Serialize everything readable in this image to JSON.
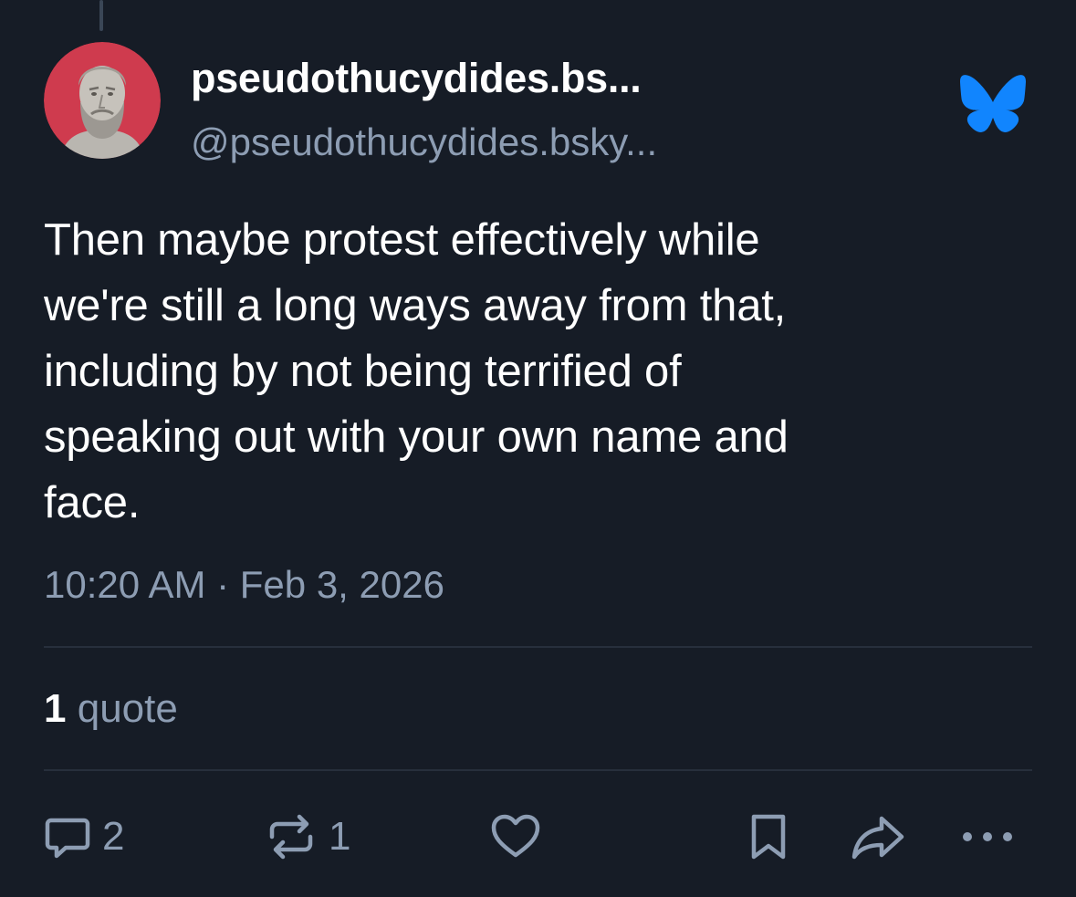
{
  "post": {
    "author": {
      "display_name": "pseudothucydides.bs...",
      "handle": "@pseudothucydides.bsky..."
    },
    "text_lines": [
      "Then maybe protest effectively while",
      "we're still a long ways away from that,",
      "including by not being terrified of",
      "speaking out with your own name and",
      "face."
    ],
    "timestamp": "10:20 AM · Feb 3, 2026",
    "quote_count": "1",
    "quote_label": "quote",
    "actions": {
      "reply_count": "2",
      "repost_count": "1"
    }
  },
  "icons": {
    "app_logo": "bluesky-butterfly-icon",
    "reply": "speech-bubble-icon",
    "repost": "repost-arrows-icon",
    "like": "heart-icon",
    "bookmark": "bookmark-icon",
    "share": "share-arrow-icon",
    "more": "ellipsis-icon"
  },
  "colors": {
    "background": "#161c26",
    "text_primary": "#ffffff",
    "text_secondary": "#8d9db3",
    "brand": "#1185fe",
    "avatar_bg": "#cf3b4e"
  }
}
